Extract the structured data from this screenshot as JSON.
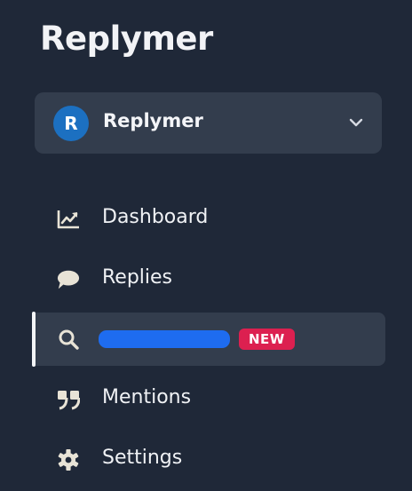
{
  "brand": {
    "title": "Replymer"
  },
  "workspace": {
    "avatar_initial": "R",
    "name": "Replymer"
  },
  "nav": {
    "items": [
      {
        "label": "Dashboard",
        "icon": "chart-line-icon"
      },
      {
        "label": "Replies",
        "icon": "chat-bubble-icon"
      },
      {
        "label": "",
        "icon": "search-icon",
        "badge": "NEW",
        "active": true
      },
      {
        "label": "Mentions",
        "icon": "quote-icon"
      },
      {
        "label": "Settings",
        "icon": "gear-icon"
      }
    ]
  },
  "colors": {
    "background": "#1f2838",
    "panel": "#333d4d",
    "avatar": "#1c70c1",
    "badge": "#dc2050"
  }
}
